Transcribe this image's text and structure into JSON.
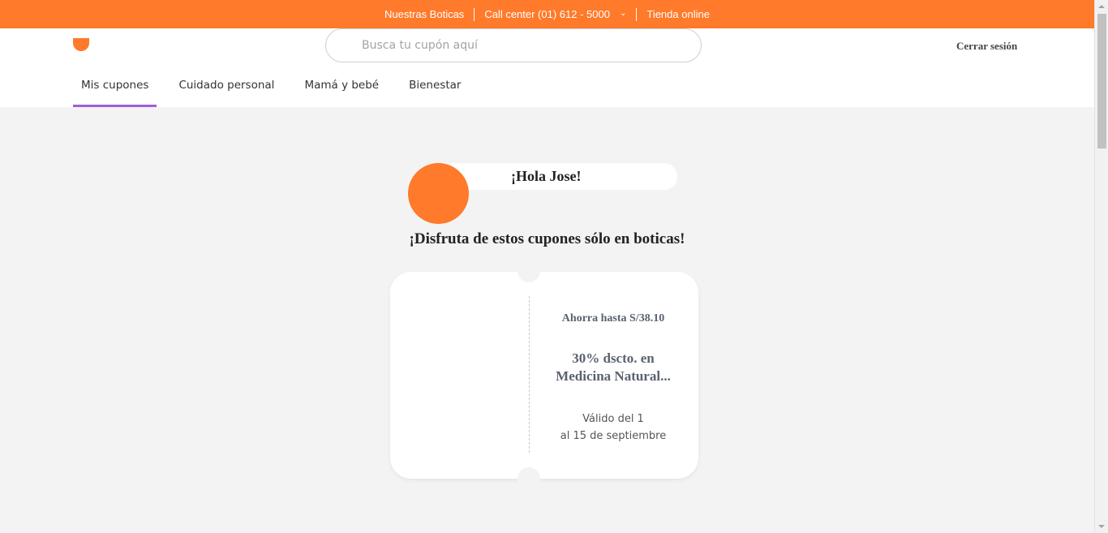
{
  "topbar": {
    "store_link": "Nuestras Boticas",
    "call_center": "Call center (01) 612 - 5000",
    "online_store": "Tienda online",
    "bg_color": "#ff7a2a"
  },
  "header": {
    "search_placeholder": "Busca tu cupón aquí",
    "logout_label": "Cerrar sesión"
  },
  "nav": {
    "tabs": [
      {
        "label": "Mis cupones",
        "active": true
      },
      {
        "label": "Cuidado personal",
        "active": false
      },
      {
        "label": "Mamá y bebé",
        "active": false
      },
      {
        "label": "Bienestar",
        "active": false
      }
    ],
    "active_color": "#a25cdb"
  },
  "main": {
    "greeting": "¡Hola Jose!",
    "subtitle": "¡Disfruta de estos cupones sólo en boticas!"
  },
  "coupon": {
    "savings": "Ahorra hasta S/38.10",
    "title_line1": "30% dscto. en",
    "title_line2": "Medicina Natural...",
    "valid_line1": "Válido del 1",
    "valid_line2": "al 15 de septiembre"
  }
}
